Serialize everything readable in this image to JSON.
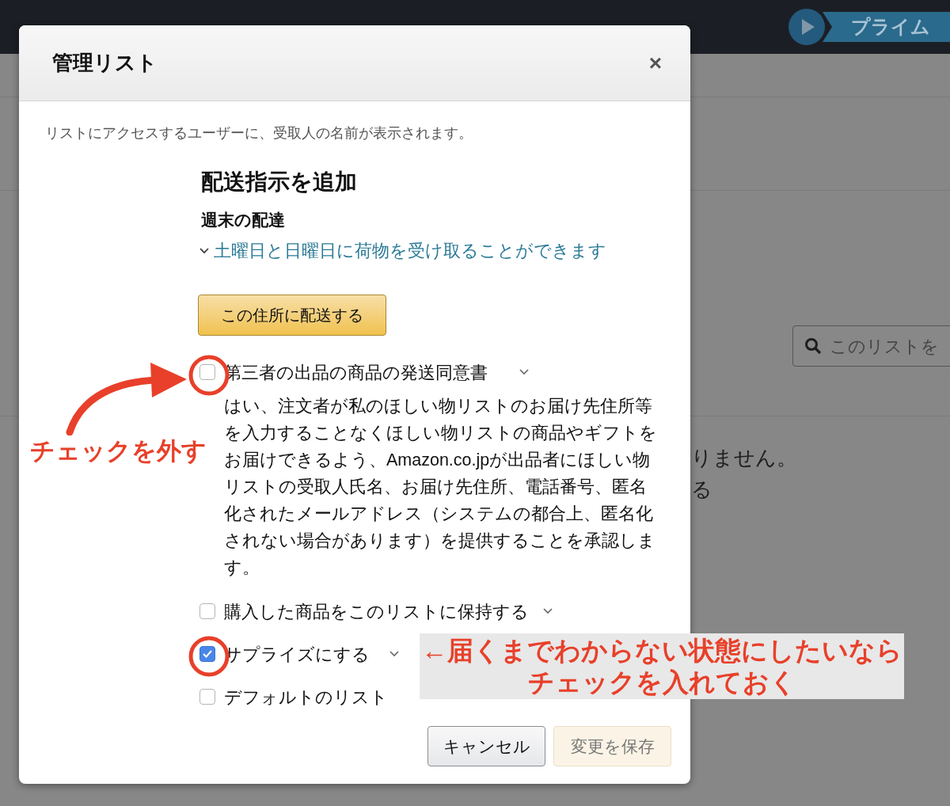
{
  "nav": {
    "prime_label": "プライム"
  },
  "background": {
    "search_placeholder": "このリストを",
    "texts": [
      "りません。",
      "る"
    ]
  },
  "dialog": {
    "title": "管理リスト",
    "close": "×",
    "notice": "リストにアクセスするユーザーに、受取人の名前が表示されます。",
    "section_title": "配送指示を追加",
    "weekend_heading": "週末の配達",
    "weekend_link": "土曜日と日曜日に荷物を受け取ることができます",
    "address_button": "この住所に配送する",
    "options": [
      {
        "kind": "expandable",
        "label": "第三者の出品の商品の発送同意書",
        "checked": false,
        "description": "はい、注文者が私のほしい物リストのお届け先住所等を入力することなくほしい物リストの商品やギフトをお届けできるよう、Amazon.co.jpが出品者にほしい物リストの受取人氏名、お届け先住所、電話番号、匿名化されたメールアドレス（システムの都合上、匿名化されない場合があります）を提供することを承認します。"
      },
      {
        "kind": "expandable",
        "label": "購入した商品をこのリストに保持する",
        "checked": false
      },
      {
        "kind": "expandable",
        "label": "サプライズにする",
        "checked": true
      },
      {
        "kind": "plain",
        "label": "デフォルトのリスト",
        "checked": false
      }
    ],
    "buttons": [
      {
        "label": "キャンセル",
        "disabled": false
      },
      {
        "label": "変更を保存",
        "disabled": true
      }
    ]
  },
  "annotations": [
    {
      "lines": [
        "チェックを外す"
      ]
    },
    {
      "lines": [
        "←届くまでわからない状態にしたいなら",
        "チェックを入れておく"
      ]
    }
  ]
}
